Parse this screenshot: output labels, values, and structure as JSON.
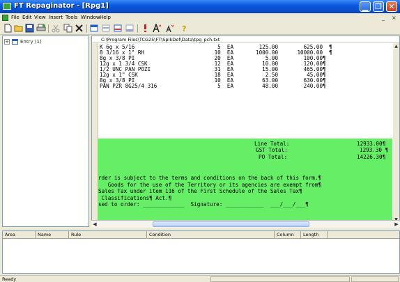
{
  "window": {
    "title": "FT Repaginator - [Rpg1]",
    "minimize_glyph": "▁",
    "maximize_glyph": "❐",
    "close_glyph": "✕"
  },
  "menu": {
    "items": [
      "File",
      "Edit",
      "View",
      "Insert",
      "Tools",
      "Window",
      "Help"
    ],
    "mdi_minimize": "_",
    "mdi_close": "×"
  },
  "toolbar": {
    "buttons": [
      {
        "name": "new-file-icon",
        "glyph": "📄"
      },
      {
        "name": "open-folder-icon",
        "glyph": "📂"
      },
      {
        "name": "save-icon",
        "glyph": "💾"
      },
      {
        "name": "print-icon",
        "glyph": "🖨"
      },
      {
        "name": "cut-icon",
        "glyph": "✂"
      },
      {
        "name": "copy-icon",
        "glyph": "⧉"
      },
      {
        "name": "delete-icon",
        "glyph": "✖"
      },
      {
        "name": "page-first-icon",
        "glyph": "▤"
      },
      {
        "name": "page-prev-icon",
        "glyph": "▥"
      },
      {
        "name": "page-next-icon",
        "glyph": "▦"
      },
      {
        "name": "page-last-icon",
        "glyph": "▧"
      },
      {
        "name": "exclamation-icon",
        "glyph": "!"
      },
      {
        "name": "font-large-icon",
        "glyph": "A"
      },
      {
        "name": "font-small-icon",
        "glyph": "A"
      },
      {
        "name": "help-icon",
        "glyph": "?"
      }
    ]
  },
  "tree": {
    "expander": "+",
    "node_label": "Entry (1)"
  },
  "document": {
    "path": "C:\\Program Files\\TCG25\\FT\\SpIkDef\\Data\\tpg_pch.txt",
    "lines": [
      "K 6g x 5/16                          5  EA        125.00        625.00  ¶",
      "8 3/16 x 1\" RH                      10  EA       1000.00      10000.00  ¶",
      "8g x 3/8 PI                         20  EA          5.00        100.00¶",
      "12g x 1 3/4 CSK                     12  EA         10.00        120.00¶",
      "1/2 UNC PAN POZI                    31  EA         15.00        465.00¶",
      "12g x 1\" CSK                        18  EA          2.50         45.00¶",
      "8g x 3/8 PI                         10  EA         63.00        630.00¶",
      "PAN PZR 8G25/4 316                   5  EA         48.00        240.00¶"
    ],
    "totals": [
      {
        "label": "Line Total:",
        "value": "12933.00¶"
      },
      {
        "label": "GST Total:",
        "value": "1293.30 ¶"
      },
      {
        "label": "PO Total:",
        "value": "14226.30¶"
      }
    ],
    "footer_lines": [
      "rder is subject to the terms and conditions on the back of this form.¶",
      "   Goods for the use of the Territory or its agencies are exempt from¶",
      "Sales Tax under item 116 of the First Schedule of the Sales Tax¶",
      " Classifications¶ Act.¶",
      "sed to order: _____________  Signature: ____________  ___/___/___¶"
    ],
    "highlight_color": "#66ee66"
  },
  "grid": {
    "columns": [
      "Area",
      "Name",
      "Rule",
      "Condition",
      "Column",
      "Length"
    ]
  },
  "status": {
    "text": "Ready"
  }
}
